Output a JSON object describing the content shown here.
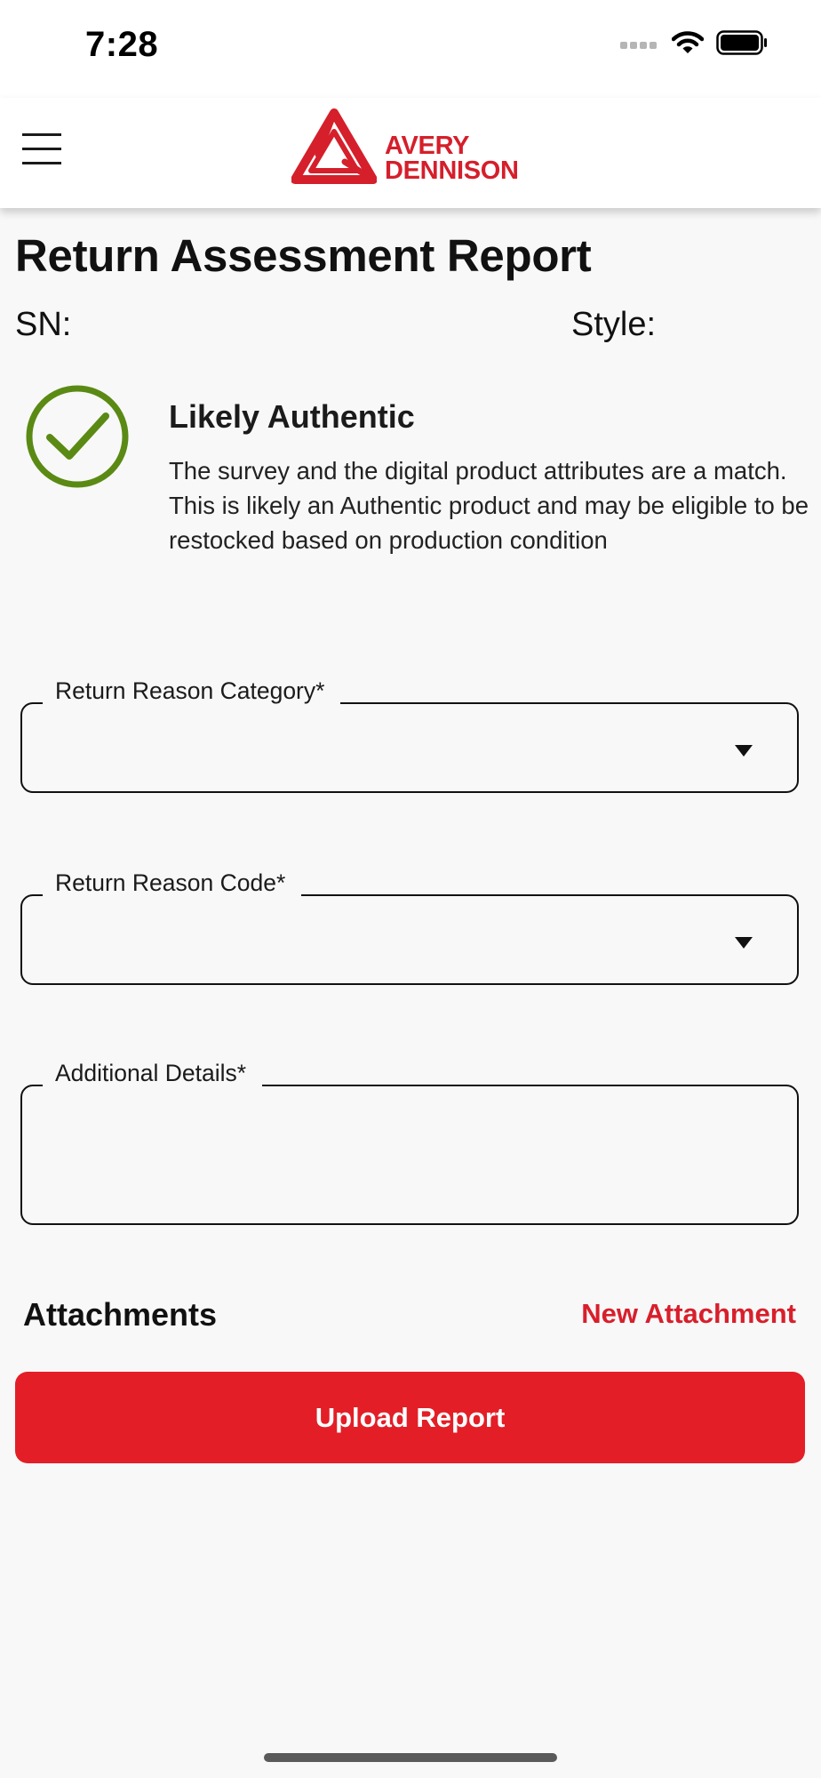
{
  "status_bar": {
    "time": "7:28",
    "icons": [
      "cellular-signal-icon",
      "wifi-icon",
      "battery-icon"
    ]
  },
  "header": {
    "menu_icon": "hamburger-menu-icon",
    "logo": {
      "line1": "AVERY",
      "line2": "DENNISON"
    }
  },
  "page": {
    "title": "Return Assessment Report",
    "sn_label": "SN:",
    "style_label": "Style:"
  },
  "result": {
    "icon": "check-circle-icon",
    "title": "Likely Authentic",
    "description": "The survey and the digital product attributes are a match. This is likely an Authentic product and may be eligible to be restocked based on production condition"
  },
  "form": {
    "category_label": "Return Reason Category*",
    "code_label": "Return Reason Code*",
    "details_label": "Additional Details*"
  },
  "attachments": {
    "title": "Attachments",
    "new_label": "New Attachment"
  },
  "actions": {
    "upload_label": "Upload Report"
  },
  "colors": {
    "brand_red": "#d51f2b",
    "button_red": "#e31e27",
    "check_green": "#5a8a14",
    "background": "#f8f8f8"
  }
}
